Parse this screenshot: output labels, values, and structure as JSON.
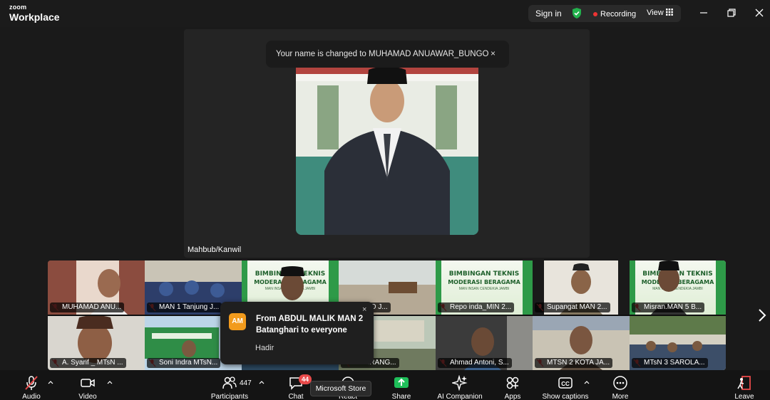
{
  "app": {
    "brand_top": "zoom",
    "brand_bottom": "Workplace",
    "sign_in": "Sign in",
    "recording": "Recording",
    "view": "View"
  },
  "speaker": {
    "name": "Mahbub/Kanwil"
  },
  "notification": {
    "text": "Your name is changed to MUHAMAD ANUAWAR_BUNGO",
    "close": "×"
  },
  "gallery": {
    "row1": [
      {
        "name": "MUHAMAD ANU...",
        "banner": false
      },
      {
        "name": "MAN 1 Tanjung J...",
        "banner": false
      },
      {
        "name": "",
        "banner": true
      },
      {
        "name": "2 MUARO J...",
        "banner": false
      },
      {
        "name": "Repo inda_MIN 2...",
        "banner": true
      },
      {
        "name": "Supangat MAN 2...",
        "banner": false
      },
      {
        "name": "Misran.MAN 5 B...",
        "banner": true
      }
    ],
    "row2": [
      {
        "name": "A. Syarif _ MTsN ..."
      },
      {
        "name": "Soni Indra MTsN..."
      },
      {
        "name": ""
      },
      {
        "name": "3 MERANG..."
      },
      {
        "name": "Ahmad Antoni, S..."
      },
      {
        "name": "MTSN 2 KOTA JA..."
      },
      {
        "name": "MTsN 3 SAROLA..."
      }
    ],
    "banner_text": {
      "line1": "BIMBINGAN TEKNIS",
      "line2": "MODERASI BERAGAMA",
      "line3": "MAN INSAN CENDEKIA JAMBI"
    }
  },
  "chat_popup": {
    "avatar": "AM",
    "from": "From ABDUL MALIK MAN 2 Batanghari to everyone",
    "message": "Hadir",
    "close": "×"
  },
  "toolbar": {
    "audio": "Audio",
    "video": "Video",
    "participants": "Participants",
    "participants_count": "447",
    "chat": "Chat",
    "chat_badge": "44",
    "react": "React",
    "share": "Share",
    "ai_companion": "AI Companion",
    "apps": "Apps",
    "show_captions": "Show captions",
    "more": "More",
    "leave": "Leave",
    "tooltip": "Microsoft Store"
  },
  "colors": {
    "recording_dot": "#e33333",
    "shield": "#22b14c",
    "share_green": "#1fbf5a",
    "chat_badge": "#e84a4a",
    "leave_red": "#e84a4a",
    "avatar_orange": "#f29b1d"
  }
}
